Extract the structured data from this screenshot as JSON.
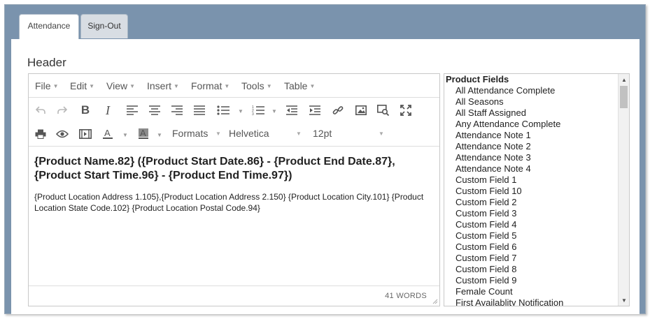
{
  "tabs": [
    {
      "label": "Attendance",
      "active": true
    },
    {
      "label": "Sign-Out",
      "active": false
    }
  ],
  "header": {
    "label": "Header"
  },
  "editor": {
    "menus": [
      "File",
      "Edit",
      "View",
      "Insert",
      "Format",
      "Tools",
      "Table"
    ],
    "toolbar": {
      "formats_label": "Formats",
      "font_family": "Helvetica",
      "font_size": "12pt"
    },
    "content": {
      "heading": "{Product Name.82} ({Product Start Date.86} - {Product End Date.87}, {Product Start Time.96} - {Product End Time.97})",
      "paragraph": "{Product Location Address 1.105},{Product Location Address 2.150} {Product Location City.101} {Product Location State Code.102} {Product Location Postal Code.94}"
    },
    "word_count": "41 WORDS"
  },
  "fields_panel": {
    "title": "Product Fields",
    "items": [
      "All Attendance Complete",
      "All Seasons",
      "All Staff Assigned",
      "Any Attendance Complete",
      "Attendance Note 1",
      "Attendance Note 2",
      "Attendance Note 3",
      "Attendance Note 4",
      "Custom Field 1",
      "Custom Field 10",
      "Custom Field 2",
      "Custom Field 3",
      "Custom Field 4",
      "Custom Field 5",
      "Custom Field 6",
      "Custom Field 7",
      "Custom Field 8",
      "Custom Field 9",
      "Female Count",
      "First Availablity Notification"
    ]
  },
  "colors": {
    "frame": "#7a93ad",
    "text": "#222222",
    "icon": "#555555"
  }
}
